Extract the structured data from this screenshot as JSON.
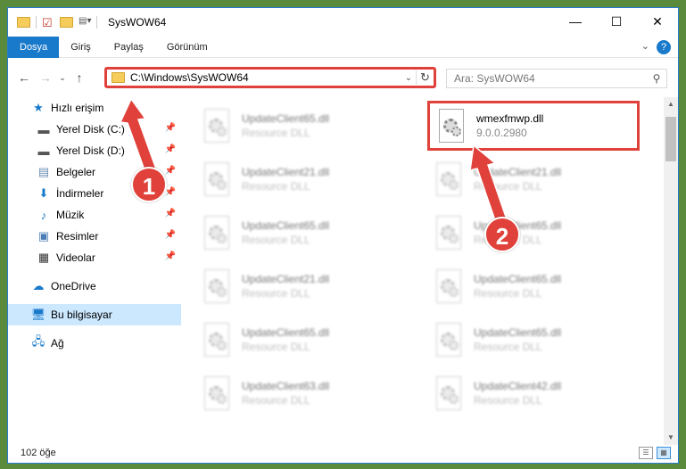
{
  "window": {
    "title": "SysWOW64",
    "controls": {
      "minimize": "—",
      "maximize": "☐",
      "close": "✕"
    }
  },
  "ribbon": {
    "tabs": [
      {
        "label": "Dosya",
        "active": true
      },
      {
        "label": "Giriş"
      },
      {
        "label": "Paylaş"
      },
      {
        "label": "Görünüm"
      }
    ],
    "help": "?"
  },
  "navigation": {
    "address": "C:\\Windows\\SysWOW64",
    "search_placeholder": "Ara: SysWOW64"
  },
  "sidebar": {
    "quick_access": "Hızlı erişim",
    "items": [
      {
        "label": "Yerel Disk (C:)",
        "icon": "drive-icon",
        "pinned": true
      },
      {
        "label": "Yerel Disk (D:)",
        "icon": "drive-icon",
        "pinned": true
      },
      {
        "label": "Belgeler",
        "icon": "documents-icon",
        "pinned": true
      },
      {
        "label": "İndirmeler",
        "icon": "download-icon",
        "pinned": true
      },
      {
        "label": "Müzik",
        "icon": "music-icon",
        "pinned": true
      },
      {
        "label": "Resimler",
        "icon": "pictures-icon",
        "pinned": true
      },
      {
        "label": "Videolar",
        "icon": "videos-icon",
        "pinned": true
      }
    ],
    "onedrive": "OneDrive",
    "this_pc": "Bu bilgisayar",
    "network": "Ağ"
  },
  "files": {
    "highlighted": {
      "name": "wmexfmwp.dll",
      "version": "9.0.0.2980"
    },
    "left_column": [
      {
        "name": "UpdateClient65.dll",
        "type": "Resource DLL"
      },
      {
        "name": "UpdateClient21.dll",
        "type": "Resource DLL"
      },
      {
        "name": "UpdateClient65.dll",
        "type": "Resource DLL"
      },
      {
        "name": "UpdateClient21.dll",
        "type": "Resource DLL"
      },
      {
        "name": "UpdateClient65.dll",
        "type": "Resource DLL"
      },
      {
        "name": "UpdateClient63.dll",
        "type": "Resource DLL"
      }
    ],
    "right_column": [
      {
        "name": "UpdateClient21.dll",
        "type": "Resource DLL"
      },
      {
        "name": "UpdateClient65.dll",
        "type": "Resource DLL"
      },
      {
        "name": "UpdateClient65.dll",
        "type": "Resource DLL"
      },
      {
        "name": "UpdateClient65.dll",
        "type": "Resource DLL"
      },
      {
        "name": "UpdateClient42.dll",
        "type": "Resource DLL"
      }
    ]
  },
  "annotations": {
    "step1": "1",
    "step2": "2",
    "color": "#e0413a"
  },
  "status": {
    "count": "102 öğe"
  }
}
